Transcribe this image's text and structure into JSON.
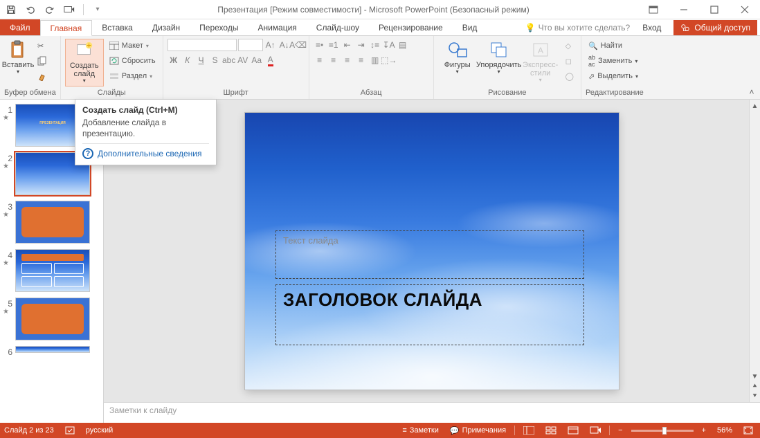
{
  "titlebar": {
    "title": "Презентация [Режим совместимости] - Microsoft PowerPoint (Безопасный режим)"
  },
  "tabs": {
    "file": "Файл",
    "home": "Главная",
    "insert": "Вставка",
    "design": "Дизайн",
    "transitions": "Переходы",
    "animation": "Анимация",
    "slideshow": "Слайд-шоу",
    "review": "Рецензирование",
    "view": "Вид",
    "tell_me": "Что вы хотите сделать?",
    "signin": "Вход",
    "share": "Общий доступ"
  },
  "ribbon": {
    "clipboard": {
      "label": "Буфер обмена",
      "paste": "Вставить"
    },
    "slides": {
      "label": "Слайды",
      "new_slide": "Создать слайд",
      "layout": "Макет",
      "reset": "Сбросить",
      "section": "Раздел"
    },
    "font": {
      "label": "Шрифт"
    },
    "paragraph": {
      "label": "Абзац"
    },
    "drawing": {
      "label": "Рисование",
      "shapes": "Фигуры",
      "arrange": "Упорядочить",
      "quick_styles": "Экспресс-стили"
    },
    "editing": {
      "label": "Редактирование",
      "find": "Найти",
      "replace": "Заменить",
      "select": "Выделить"
    }
  },
  "tooltip": {
    "title": "Создать слайд (Ctrl+M)",
    "body": "Добавление слайда в презентацию.",
    "link": "Дополнительные сведения"
  },
  "slide": {
    "subtitle_placeholder": "Текст слайда",
    "title_placeholder": "ЗАГОЛОВОК СЛАЙДА"
  },
  "thumbnails": {
    "count": 6,
    "selected": 2
  },
  "notes": {
    "placeholder": "Заметки к слайду"
  },
  "statusbar": {
    "slide_info": "Слайд 2 из 23",
    "language": "русский",
    "notes_btn": "Заметки",
    "comments_btn": "Примечания",
    "zoom_pct": "56%"
  }
}
